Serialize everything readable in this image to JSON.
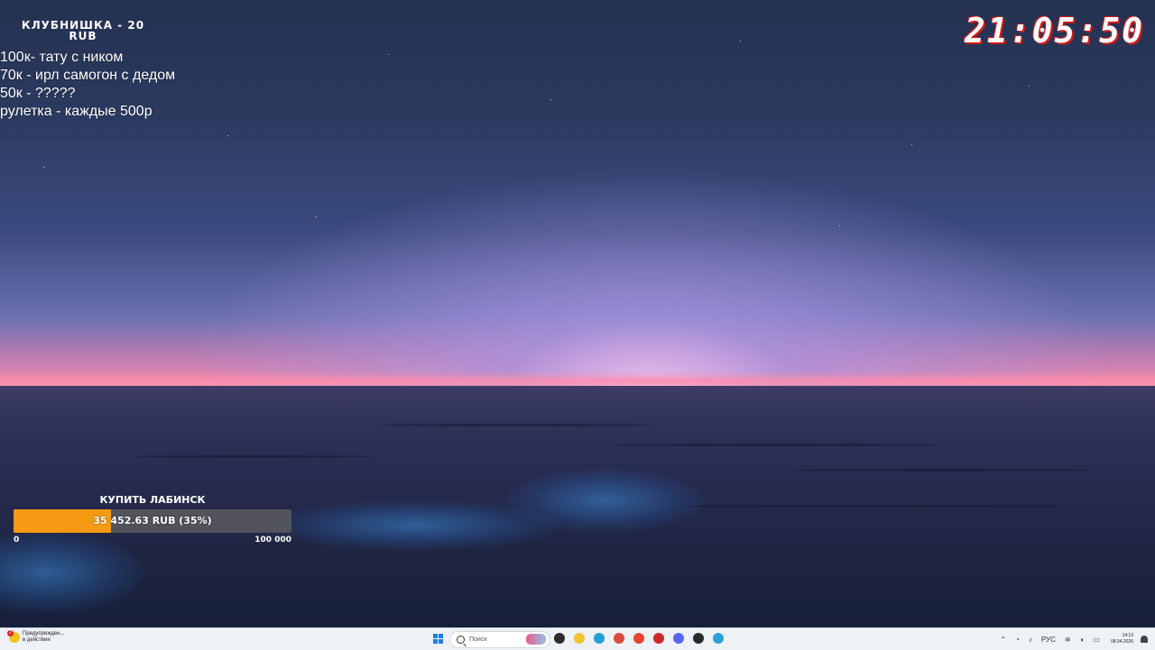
{
  "stream_overlay": {
    "donation_title_line1": "КЛУБНИШКА   -   20",
    "donation_title_line2": "RUB",
    "goal_list": [
      "100к- тату с ником",
      "70к - ирл самогон с дедом",
      "50к - ?????",
      "рулетка - каждые 500р"
    ],
    "clock": "21:05:50",
    "goal": {
      "label": "КУПИТЬ ЛАБИНСК",
      "progress_text": "35 452.63 RUB (35%)",
      "progress_fraction": 0.35,
      "min_label": "0",
      "max_label": "100 000",
      "fill_color": "#f59a12"
    }
  },
  "taskbar": {
    "notification_line1": "Предупрежден...",
    "notification_line2": "в действии",
    "notification_badge": "2",
    "search_placeholder": "Поиск",
    "tray_language": "РУС",
    "tray_time": "14:13",
    "tray_date": "08.04.2026",
    "apps": [
      {
        "name": "task-view-icon",
        "color": "#2b2b2b"
      },
      {
        "name": "file-explorer-icon",
        "color": "#f2c230"
      },
      {
        "name": "edge-icon",
        "color": "#1fa0d8"
      },
      {
        "name": "chrome-icon",
        "color": "#dd4b3e"
      },
      {
        "name": "yandex-browser-icon",
        "color": "#e8442e"
      },
      {
        "name": "app-red-icon",
        "color": "#cc2a2a"
      },
      {
        "name": "discord-icon",
        "color": "#5865f2"
      },
      {
        "name": "obs-icon",
        "color": "#2a2a2a"
      },
      {
        "name": "telegram-icon",
        "color": "#2aa3d8"
      }
    ]
  }
}
